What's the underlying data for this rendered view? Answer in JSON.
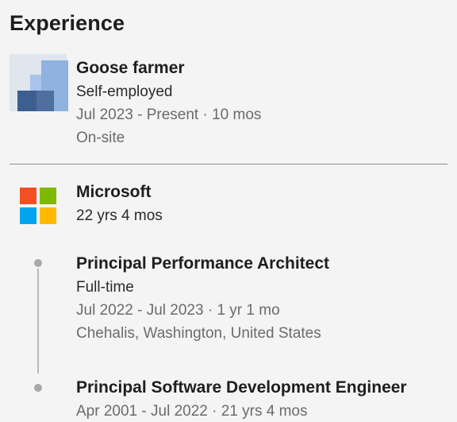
{
  "section": {
    "title": "Experience"
  },
  "entries": [
    {
      "title": "Goose farmer",
      "employment": "Self-employed",
      "dates": "Jul 2023 - Present · 10 mos",
      "location": "On-site",
      "logo_icon": "generic-company-logo-icon"
    }
  ],
  "company": {
    "name": "Microsoft",
    "duration": "22 yrs 4 mos",
    "logo_icon": "microsoft-logo-icon",
    "logo_colors": [
      "#f25022",
      "#7fba00",
      "#00a4ef",
      "#ffb900"
    ],
    "roles": [
      {
        "title": "Principal Performance Architect",
        "employment": "Full-time",
        "dates": "Jul 2022 - Jul 2023 · 1 yr 1 mo",
        "location": "Chehalis, Washington, United States"
      },
      {
        "title": "Principal Software Development Engineer",
        "dates": "Apr 2001 - Jul 2022 · 21 yrs 4 mos"
      }
    ]
  }
}
